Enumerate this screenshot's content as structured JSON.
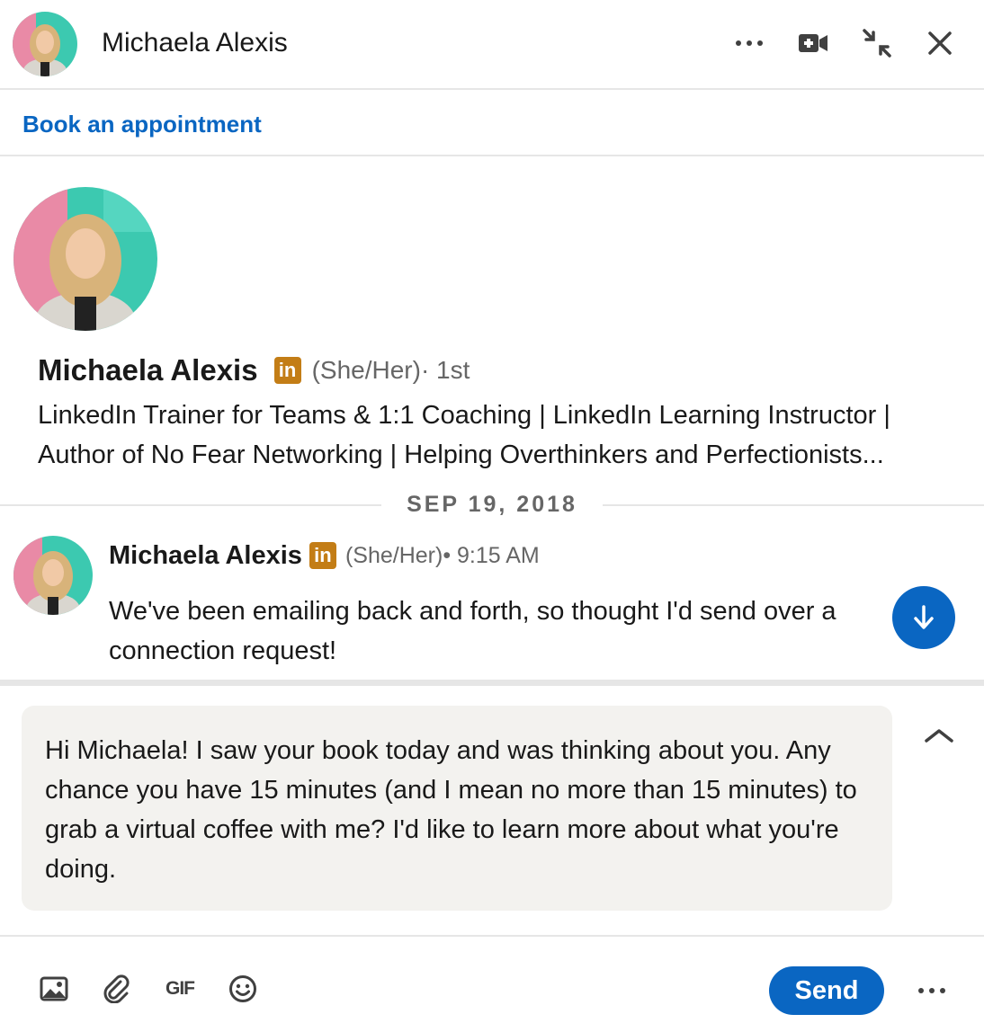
{
  "header": {
    "name": "Michaela Alexis",
    "icons": [
      "more-horizontal-icon",
      "video-call-icon",
      "minimize-icon",
      "close-icon"
    ]
  },
  "book": {
    "label": "Book an appointment"
  },
  "profile": {
    "name": "Michaela Alexis",
    "badge": "in",
    "pronouns": "(She/Her)",
    "degree": " · 1st",
    "headline_line1": "LinkedIn Trainer for Teams & 1:1 Coaching | LinkedIn Learning Instructor |",
    "headline_line2": "Author of No Fear Networking | Helping Overthinkers and Perfectionists..."
  },
  "divider": {
    "date": "SEP 19, 2018"
  },
  "message": {
    "sender": "Michaela Alexis",
    "badge": "in",
    "pronouns": "(She/Her)",
    "time": " • 9:15 AM",
    "text": "We've been emailing back and forth, so thought I'd send over a connection request!"
  },
  "compose": {
    "text": "Hi Michaela! I saw your book today and was thinking about you. Any chance you have 15 minutes (and I mean no more than 15 minutes) to grab a virtual coffee with me? I'd like to learn more about what you're doing."
  },
  "footer": {
    "gif_label": "GIF",
    "send_label": "Send",
    "icons": [
      "image-icon",
      "paperclip-icon",
      "gif-icon",
      "emoji-icon",
      "more-horizontal-icon"
    ]
  },
  "colors": {
    "accent": "#0a66c2",
    "badge": "#c37d16",
    "compose_bg": "#f3f2ef",
    "muted_text": "#666666"
  }
}
